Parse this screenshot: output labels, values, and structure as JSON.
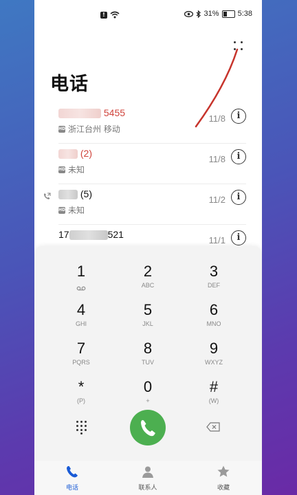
{
  "status_bar": {
    "alert_glyph": "!",
    "battery_percent": "31%",
    "time": "5:38"
  },
  "header": {
    "title": "电话",
    "more_icon": "more-dots-icon"
  },
  "call_log": [
    {
      "name_visible": "5455",
      "sub": "浙江台州 移动",
      "date": "11/8",
      "missed": true
    },
    {
      "name_visible": "(2)",
      "sub": "未知",
      "date": "11/8",
      "missed": true
    },
    {
      "name_visible": "(5)",
      "sub": "未知",
      "date": "11/2",
      "missed": false
    },
    {
      "name_prefix": "17",
      "name_suffix": "521",
      "date": "11/1",
      "missed": false
    }
  ],
  "dialpad": {
    "keys": [
      {
        "digit": "1",
        "letters": ""
      },
      {
        "digit": "2",
        "letters": "ABC"
      },
      {
        "digit": "3",
        "letters": "DEF"
      },
      {
        "digit": "4",
        "letters": "GHI"
      },
      {
        "digit": "5",
        "letters": "JKL"
      },
      {
        "digit": "6",
        "letters": "MNO"
      },
      {
        "digit": "7",
        "letters": "PQRS"
      },
      {
        "digit": "8",
        "letters": "TUV"
      },
      {
        "digit": "9",
        "letters": "WXYZ"
      },
      {
        "digit": "*",
        "letters": "(P)"
      },
      {
        "digit": "0",
        "letters": "+"
      },
      {
        "digit": "#",
        "letters": "(W)"
      }
    ]
  },
  "bottom_nav": {
    "items": [
      {
        "label": "电话",
        "icon": "phone-icon",
        "active": true
      },
      {
        "label": "联系人",
        "icon": "person-icon",
        "active": false
      },
      {
        "label": "收藏",
        "icon": "star-icon",
        "active": false
      }
    ]
  },
  "colors": {
    "missed": "#d0443c",
    "call_button": "#4caf50",
    "active_tab": "#1a5bd6"
  }
}
